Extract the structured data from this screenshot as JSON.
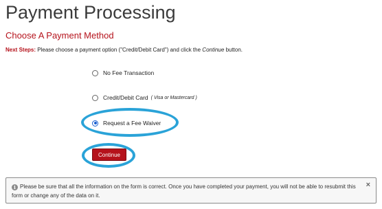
{
  "header": {
    "title": "Payment Processing"
  },
  "section": {
    "title": "Choose A Payment Method"
  },
  "next_steps": {
    "label": "Next Steps:",
    "text_before": "Please choose a payment option (\"Credit/Debit Card\") and click the",
    "emphasis": "Continue",
    "text_after": "button."
  },
  "options": [
    {
      "label": "No Fee Transaction",
      "note": "",
      "selected": false
    },
    {
      "label": "Credit/Debit Card",
      "note": "( Visa or Mastercard )",
      "selected": false
    },
    {
      "label": "Request a Fee Waiver",
      "note": "",
      "selected": true
    }
  ],
  "continue_button": {
    "label": "Continue"
  },
  "notice": {
    "icon": "info-icon",
    "text": "Please be sure that all the information on the form is correct. Once you have completed your payment, you will not be able to resubmit this form or change any of the data on it.",
    "close_symbol": "×"
  },
  "colors": {
    "accent": "#b5121b",
    "highlight": "#2aa3d8",
    "radio_selected": "#1a5fd0"
  }
}
